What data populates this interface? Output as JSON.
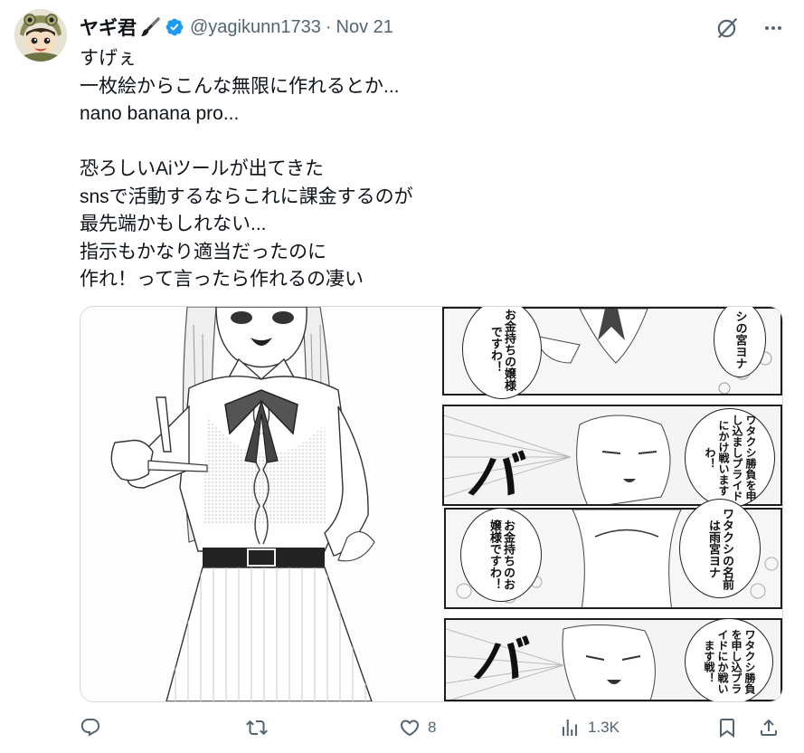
{
  "tweet": {
    "display_name": "ヤギ君",
    "handle": "@yagikunn1733",
    "separator": "·",
    "date": "Nov 21",
    "text_lines": [
      "すげぇ",
      "一枚絵からこんな無限に作れるとか...",
      "nano banana pro...",
      "",
      "恐ろしいAiツールが出てきた",
      "snsで活動するならこれに課金するのが",
      "最先端かもしれない...",
      "指示もかなり適当だったのに",
      "作れ！って言ったら作れるの凄い"
    ]
  },
  "media": {
    "manga": {
      "bubble_1": "お金持ちの嬢様ですわ！",
      "bubble_2": "シの宮ヨナ",
      "bubble_3": "ワタクシ勝負を申し込ましプライドにかけ戦いますわ！",
      "bubble_4": "お金持ちのお嬢様ですわ！",
      "bubble_5": "ワタクシの名前は雨宮ヨナ",
      "bubble_6": "ワタクシ勝負を申し込プライドにか戦います戦！",
      "sfx_1": "バ",
      "sfx_2": "バ"
    }
  },
  "actions": {
    "reply_count": "",
    "retweet_count": "",
    "like_count": "8",
    "views_count": "1.3K"
  },
  "colors": {
    "text_primary": "#0f1419",
    "text_secondary": "#536471",
    "verified": "#1d9bf0",
    "border": "#cfd9de"
  },
  "icons": {
    "avatar": "avatar-image",
    "name_emoji": "paintbrush-icon",
    "verified": "verified-badge-icon",
    "grok": "grok-icon",
    "more": "more-icon",
    "reply": "reply-icon",
    "retweet": "retweet-icon",
    "like": "heart-icon",
    "views": "views-icon",
    "bookmark": "bookmark-icon",
    "share": "share-icon"
  }
}
